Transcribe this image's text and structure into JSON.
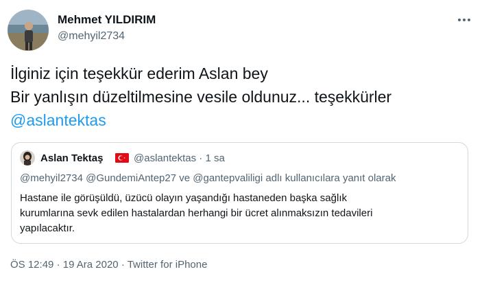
{
  "author": {
    "name": "Mehmet YILDIRIM",
    "handle": "@mehyil2734"
  },
  "tweet": {
    "line1": "İlginiz için teşekkür ederim Aslan bey",
    "line2": "Bir yanlışın düzeltilmesine vesile oldunuz... teşekkürler",
    "mention": "@aslantektas"
  },
  "quoted": {
    "name": "Aslan Tektaş",
    "handle": "@aslantektas",
    "separator": "·",
    "time": "1 sa",
    "reply_line": "@mehyil2734 @GundemiAntep27 ve @gantepvaliligi adlı kullanıcılara yanıt olarak",
    "body_line1": "Hastane ile görüşüldü, üzücü olayın yaşandığı hastaneden başka sağlık",
    "body_line2": "kurumlarına sevk edilen hastalardan herhangi bir ücret alınmaksızın tedavileri",
    "body_line3": "yapılacaktır."
  },
  "meta": {
    "time": "ÖS 12:49",
    "separator": "·",
    "date": "19 Ara 2020",
    "source": "Twitter for iPhone"
  },
  "icons": {
    "more": "more-horizontal-icon",
    "flag": "turkey-flag-icon"
  },
  "colors": {
    "link": "#1d9bf0",
    "secondary_text": "#536471",
    "border": "#cfd9de",
    "flag_red": "#e30a17"
  }
}
